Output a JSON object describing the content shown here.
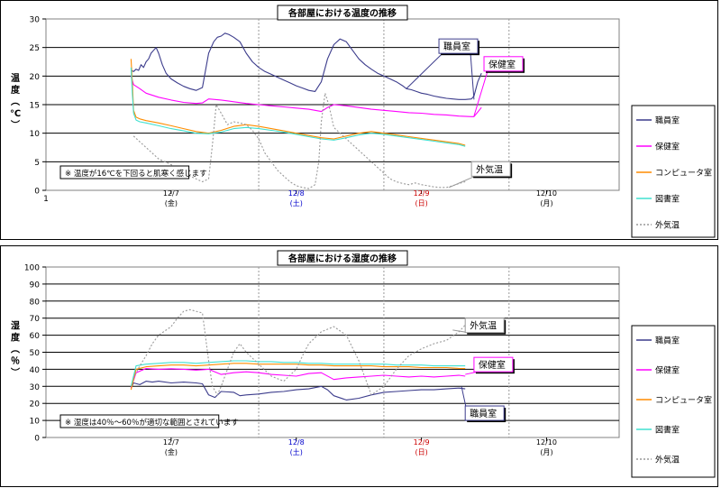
{
  "chart_data": [
    {
      "type": "line",
      "title": "各部屋における温度の推移",
      "ylabel": "温度（℃）",
      "ylim": [
        0,
        30
      ],
      "yticks": [
        0,
        5,
        10,
        15,
        20,
        25,
        30
      ],
      "x_tick_first": "1",
      "x_ticks": [
        {
          "pos": 1,
          "date": "12/7",
          "day": "(金)",
          "color": "#000000"
        },
        {
          "pos": 2,
          "date": "12/8",
          "day": "(土)",
          "color": "#0000cc"
        },
        {
          "pos": 3,
          "date": "12/9",
          "day": "(日)",
          "color": "#cc0000"
        },
        {
          "pos": 4,
          "date": "12/10",
          "day": "(月)",
          "color": "#000000"
        }
      ],
      "xlim": [
        0,
        4.58
      ],
      "note": "※ 温度が16℃を下回ると肌寒く感じます",
      "legend": [
        "職員室",
        "保健室",
        "コンピュータ室",
        "図書室",
        "外気温"
      ],
      "callouts": [
        {
          "label": "職員室",
          "series": "職員室",
          "lx": 3.14,
          "ly": 26.5,
          "px": [
            2.88,
            3.42
          ],
          "py": [
            17.8,
            15.9
          ]
        },
        {
          "label": "保健室",
          "series": "保健室",
          "lx": 3.5,
          "ly": 23.4,
          "px": [
            3.42
          ],
          "py": [
            13.0
          ]
        },
        {
          "label": "外気温",
          "series": "外気温",
          "lx": 3.4,
          "ly": 5.0,
          "px": [
            3.22
          ],
          "py": [
            0.5
          ]
        }
      ],
      "series": [
        {
          "name": "職員室",
          "color": "#3c3c8c",
          "dash": "",
          "x": [
            0.68,
            0.7,
            0.72,
            0.74,
            0.76,
            0.78,
            0.8,
            0.82,
            0.84,
            0.86,
            0.88,
            0.9,
            0.93,
            0.96,
            1.0,
            1.05,
            1.1,
            1.15,
            1.2,
            1.25,
            1.3,
            1.34,
            1.37,
            1.4,
            1.43,
            1.46,
            1.5,
            1.55,
            1.6,
            1.65,
            1.7,
            1.75,
            1.8,
            1.85,
            1.9,
            1.95,
            2.0,
            2.05,
            2.1,
            2.15,
            2.2,
            2.25,
            2.3,
            2.35,
            2.4,
            2.45,
            2.5,
            2.55,
            2.6,
            2.65,
            2.7,
            2.75,
            2.8,
            2.85,
            2.88,
            2.92,
            2.96,
            3.0,
            3.05,
            3.1,
            3.15,
            3.2,
            3.25,
            3.3,
            3.35,
            3.4,
            3.42,
            3.45,
            3.48
          ],
          "y": [
            21.0,
            20.8,
            21.2,
            21.0,
            22.0,
            21.5,
            22.5,
            23.0,
            24.0,
            24.5,
            25.0,
            24.0,
            22.0,
            20.5,
            19.5,
            18.8,
            18.2,
            17.8,
            17.5,
            18.0,
            24.0,
            26.0,
            26.8,
            27.0,
            27.5,
            27.3,
            26.8,
            26.0,
            24.0,
            22.5,
            21.5,
            20.8,
            20.3,
            19.8,
            19.3,
            18.8,
            18.3,
            17.9,
            17.5,
            17.3,
            19.0,
            23.0,
            25.5,
            26.5,
            26.0,
            24.5,
            23.0,
            22.0,
            21.2,
            20.5,
            20.0,
            19.5,
            19.0,
            18.3,
            17.8,
            17.6,
            17.3,
            17.0,
            16.8,
            16.5,
            16.3,
            16.1,
            16.0,
            15.9,
            15.9,
            16.0,
            16.5,
            19.0,
            20.5
          ]
        },
        {
          "name": "保健室",
          "color": "#ff00ff",
          "dash": "",
          "x": [
            0.68,
            0.7,
            0.75,
            0.8,
            0.9,
            1.0,
            1.1,
            1.2,
            1.25,
            1.3,
            1.4,
            1.5,
            1.6,
            1.7,
            1.8,
            1.9,
            2.0,
            2.1,
            2.2,
            2.25,
            2.3,
            2.4,
            2.5,
            2.6,
            2.7,
            2.8,
            2.9,
            3.0,
            3.1,
            3.2,
            3.3,
            3.4,
            3.42,
            3.48
          ],
          "y": [
            20.0,
            18.5,
            17.8,
            17.0,
            16.3,
            15.8,
            15.4,
            15.2,
            15.3,
            16.0,
            15.8,
            15.5,
            15.2,
            15.0,
            14.8,
            14.6,
            14.4,
            14.2,
            13.8,
            14.5,
            15.0,
            14.8,
            14.5,
            14.2,
            14.0,
            13.8,
            13.6,
            13.5,
            13.3,
            13.2,
            13.0,
            12.9,
            12.9,
            14.5
          ]
        },
        {
          "name": "コンピュータ室",
          "color": "#ff8c00",
          "dash": "",
          "x": [
            0.68,
            0.69,
            0.7,
            0.72,
            0.75,
            0.8,
            0.9,
            1.0,
            1.1,
            1.2,
            1.3,
            1.4,
            1.5,
            1.6,
            1.7,
            1.8,
            1.9,
            2.0,
            2.1,
            2.2,
            2.3,
            2.4,
            2.5,
            2.6,
            2.7,
            2.8,
            2.9,
            3.0,
            3.1,
            3.2,
            3.3,
            3.35
          ],
          "y": [
            23.0,
            19.0,
            14.0,
            12.8,
            12.5,
            12.2,
            11.8,
            11.3,
            10.8,
            10.3,
            10.0,
            10.5,
            11.2,
            11.5,
            11.2,
            10.8,
            10.4,
            10.0,
            9.6,
            9.2,
            9.0,
            9.5,
            10.0,
            10.3,
            10.0,
            9.7,
            9.4,
            9.1,
            8.8,
            8.5,
            8.2,
            7.9
          ]
        },
        {
          "name": "図書室",
          "color": "#40e0d0",
          "dash": "",
          "x": [
            0.68,
            0.69,
            0.7,
            0.72,
            0.75,
            0.8,
            0.9,
            1.0,
            1.1,
            1.2,
            1.3,
            1.4,
            1.5,
            1.6,
            1.7,
            1.8,
            1.9,
            2.0,
            2.1,
            2.2,
            2.3,
            2.4,
            2.5,
            2.6,
            2.7,
            2.8,
            2.9,
            3.0,
            3.1,
            3.2,
            3.3,
            3.35
          ],
          "y": [
            21.5,
            17.0,
            13.5,
            12.3,
            12.0,
            11.8,
            11.3,
            10.8,
            10.4,
            10.0,
            9.9,
            10.2,
            10.8,
            11.0,
            10.8,
            10.5,
            10.2,
            9.8,
            9.4,
            9.0,
            8.8,
            9.2,
            9.7,
            10.0,
            9.8,
            9.5,
            9.2,
            8.9,
            8.6,
            8.3,
            8.0,
            7.7
          ]
        },
        {
          "name": "外気温",
          "color": "#999999",
          "dash": "2,2",
          "x": [
            0.7,
            0.75,
            0.8,
            0.85,
            0.9,
            0.95,
            1.0,
            1.05,
            1.1,
            1.15,
            1.2,
            1.25,
            1.3,
            1.33,
            1.36,
            1.4,
            1.45,
            1.5,
            1.55,
            1.6,
            1.65,
            1.7,
            1.75,
            1.8,
            1.85,
            1.9,
            1.95,
            2.0,
            2.05,
            2.1,
            2.15,
            2.18,
            2.2,
            2.23,
            2.26,
            2.3,
            2.35,
            2.4,
            2.45,
            2.5,
            2.55,
            2.6,
            2.65,
            2.7,
            2.75,
            2.8,
            2.85,
            2.9,
            2.95,
            3.0,
            3.05,
            3.1,
            3.15,
            3.2,
            3.25,
            3.3,
            3.35
          ],
          "y": [
            9.5,
            8.5,
            7.5,
            6.5,
            5.5,
            5.0,
            4.5,
            3.8,
            3.0,
            2.5,
            2.0,
            1.5,
            2.0,
            8.0,
            15.0,
            13.5,
            11.5,
            12.0,
            11.8,
            11.5,
            10.5,
            9.0,
            6.5,
            5.0,
            3.5,
            2.5,
            1.5,
            0.8,
            0.5,
            0.3,
            1.0,
            5.0,
            12.0,
            17.0,
            15.0,
            11.0,
            10.0,
            9.0,
            8.0,
            7.0,
            6.0,
            5.0,
            4.0,
            3.0,
            2.0,
            1.5,
            1.2,
            1.0,
            1.3,
            1.0,
            0.8,
            0.6,
            0.5,
            0.5,
            0.8,
            1.2,
            1.5
          ]
        }
      ]
    },
    {
      "type": "line",
      "title": "各部屋における湿度の推移",
      "ylabel": "湿度（％）",
      "ylim": [
        0,
        100
      ],
      "yticks": [
        0,
        10,
        20,
        30,
        40,
        50,
        60,
        70,
        80,
        90,
        100
      ],
      "x_tick_first": "",
      "x_ticks": [
        {
          "pos": 1,
          "date": "12/7",
          "day": "(金)",
          "color": "#000000"
        },
        {
          "pos": 2,
          "date": "12/8",
          "day": "(土)",
          "color": "#0000cc"
        },
        {
          "pos": 3,
          "date": "12/9",
          "day": "(日)",
          "color": "#cc0000"
        },
        {
          "pos": 4,
          "date": "12/10",
          "day": "(月)",
          "color": "#000000"
        }
      ],
      "xlim": [
        0,
        4.58
      ],
      "note": "※ 湿度は40％～60％が適切な範囲とされています",
      "legend": [
        "職員室",
        "保健室",
        "コンピュータ室",
        "図書室",
        "外気温"
      ],
      "callouts": [
        {
          "label": "外気温",
          "series": "外気温",
          "lx": 3.35,
          "ly": 70.0,
          "px": [
            3.25
          ],
          "py": [
            63.0
          ]
        },
        {
          "label": "保健室",
          "series": "保健室",
          "lx": 3.42,
          "ly": 47.0,
          "px": [
            3.35
          ],
          "py": [
            37.0
          ]
        },
        {
          "label": "職員室",
          "series": "職員室",
          "lx": 3.35,
          "ly": 18.5,
          "px": [
            3.32
          ],
          "py": [
            30.0
          ]
        }
      ],
      "series": [
        {
          "name": "職員室",
          "color": "#3c3c8c",
          "dash": "",
          "x": [
            0.68,
            0.7,
            0.75,
            0.8,
            0.85,
            0.9,
            1.0,
            1.1,
            1.2,
            1.25,
            1.3,
            1.35,
            1.4,
            1.5,
            1.55,
            1.6,
            1.7,
            1.8,
            1.9,
            2.0,
            2.1,
            2.2,
            2.25,
            2.3,
            2.4,
            2.5,
            2.6,
            2.7,
            2.8,
            2.9,
            3.0,
            3.1,
            3.2,
            3.3,
            3.35
          ],
          "y": [
            29.0,
            32.0,
            31.0,
            33.0,
            32.5,
            33.0,
            32.0,
            32.5,
            32.0,
            31.5,
            25.0,
            23.5,
            27.0,
            26.5,
            24.5,
            25.0,
            25.5,
            26.5,
            27.0,
            28.0,
            28.5,
            30.0,
            28.0,
            24.5,
            22.0,
            23.0,
            25.0,
            26.5,
            27.0,
            27.5,
            28.0,
            28.0,
            28.5,
            29.0,
            28.5
          ]
        },
        {
          "name": "保健室",
          "color": "#ff00ff",
          "dash": "",
          "x": [
            0.68,
            0.72,
            0.8,
            0.9,
            1.0,
            1.1,
            1.2,
            1.3,
            1.4,
            1.5,
            1.6,
            1.7,
            1.8,
            1.9,
            2.0,
            2.1,
            2.2,
            2.3,
            2.4,
            2.5,
            2.6,
            2.7,
            2.8,
            2.9,
            3.0,
            3.1,
            3.2,
            3.3,
            3.35
          ],
          "y": [
            29.0,
            38.0,
            40.5,
            40.0,
            40.3,
            40.0,
            39.5,
            40.0,
            37.0,
            38.0,
            38.5,
            38.0,
            37.0,
            36.5,
            36.0,
            37.5,
            38.0,
            34.0,
            35.0,
            35.5,
            36.0,
            36.5,
            36.0,
            35.5,
            36.0,
            35.5,
            36.0,
            36.5,
            36.0
          ]
        },
        {
          "name": "コンピュータ室",
          "color": "#ff8c00",
          "dash": "",
          "x": [
            0.68,
            0.72,
            0.8,
            0.9,
            1.0,
            1.1,
            1.2,
            1.3,
            1.4,
            1.5,
            1.6,
            1.7,
            1.8,
            1.9,
            2.0,
            2.1,
            2.2,
            2.3,
            2.4,
            2.5,
            2.6,
            2.7,
            2.8,
            2.9,
            3.0,
            3.1,
            3.2,
            3.3,
            3.35
          ],
          "y": [
            28.0,
            40.0,
            41.5,
            42.0,
            42.5,
            42.5,
            42.0,
            42.5,
            43.0,
            43.5,
            43.5,
            43.0,
            43.0,
            43.0,
            43.0,
            42.5,
            42.5,
            42.0,
            42.0,
            42.0,
            42.0,
            41.5,
            41.5,
            41.5,
            41.0,
            41.0,
            41.0,
            40.5,
            40.5
          ]
        },
        {
          "name": "図書室",
          "color": "#40e0d0",
          "dash": "",
          "x": [
            0.68,
            0.72,
            0.8,
            0.9,
            1.0,
            1.1,
            1.2,
            1.3,
            1.4,
            1.5,
            1.6,
            1.7,
            1.8,
            1.9,
            2.0,
            2.1,
            2.2,
            2.3,
            2.4,
            2.5,
            2.6,
            2.7,
            2.8,
            2.9,
            3.0,
            3.1,
            3.2,
            3.3,
            3.35
          ],
          "y": [
            30.0,
            42.0,
            43.0,
            43.5,
            44.0,
            44.0,
            43.5,
            44.0,
            44.5,
            45.0,
            45.0,
            44.5,
            44.5,
            44.0,
            44.0,
            43.5,
            43.5,
            43.0,
            43.0,
            43.0,
            43.0,
            43.0,
            42.5,
            42.5,
            42.5,
            42.0,
            42.0,
            42.0,
            42.0
          ]
        },
        {
          "name": "外気温",
          "color": "#999999",
          "dash": "2,2",
          "x": [
            0.7,
            0.75,
            0.8,
            0.85,
            0.9,
            1.0,
            1.05,
            1.1,
            1.15,
            1.2,
            1.25,
            1.3,
            1.33,
            1.37,
            1.4,
            1.45,
            1.5,
            1.55,
            1.6,
            1.7,
            1.8,
            1.9,
            2.0,
            2.05,
            2.1,
            2.2,
            2.3,
            2.4,
            2.5,
            2.6,
            2.7,
            2.8,
            2.9,
            3.0,
            3.1,
            3.2,
            3.3,
            3.35
          ],
          "y": [
            35.0,
            42.0,
            48.0,
            55.0,
            60.0,
            65.0,
            70.0,
            74.0,
            75.0,
            74.0,
            73.0,
            45.0,
            30.0,
            25.0,
            30.0,
            40.0,
            50.0,
            55.0,
            50.0,
            43.0,
            36.0,
            33.0,
            40.0,
            48.0,
            55.0,
            62.0,
            65.0,
            60.0,
            45.0,
            25.0,
            30.0,
            40.0,
            48.0,
            52.0,
            55.0,
            57.0,
            62.0,
            66.0
          ]
        }
      ]
    }
  ]
}
